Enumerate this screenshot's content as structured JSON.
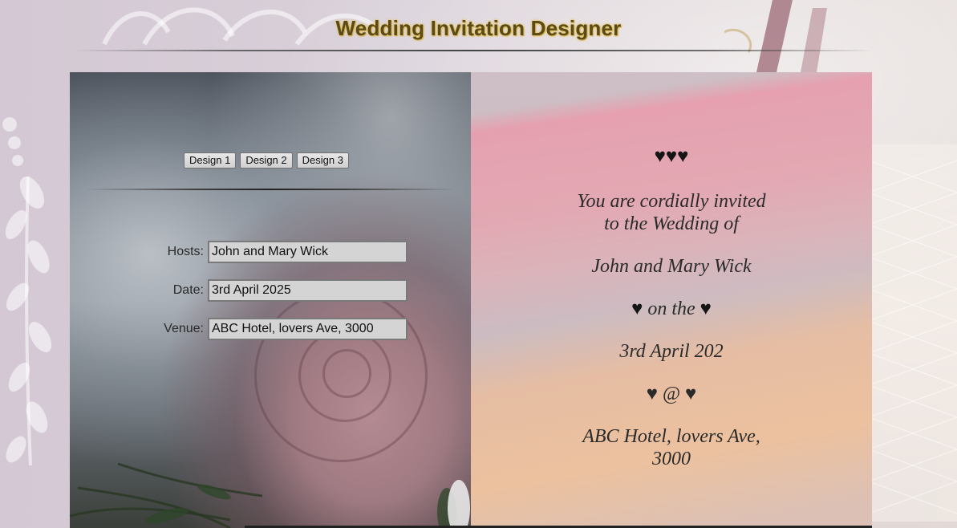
{
  "page": {
    "title": "Wedding Invitation Designer"
  },
  "designs": {
    "buttons": [
      "Design 1",
      "Design 2",
      "Design 3"
    ]
  },
  "form": {
    "hosts_label": "Hosts:",
    "hosts_value": "John and Mary Wick",
    "date_label": "Date:",
    "date_value": "3rd April 2025",
    "venue_label": "Venue:",
    "venue_value": "ABC Hotel, lovers Ave, 3000"
  },
  "invitation": {
    "hearts": "♥♥♥",
    "intro_line1": "You are cordially invited",
    "intro_line2": "to the Wedding of",
    "hosts": "John and Mary Wick",
    "heart_left": "♥",
    "on_the": " on the ",
    "heart_right": "♥",
    "date": "3rd April 202",
    "at_line": "♥ @ ♥",
    "venue_line1": "ABC Hotel, lovers Ave,",
    "venue_line2": "3000"
  },
  "colors": {
    "title_text": "#5a4a1a",
    "title_glow": "#e8c860",
    "input_bg": "#d4d4d4"
  }
}
